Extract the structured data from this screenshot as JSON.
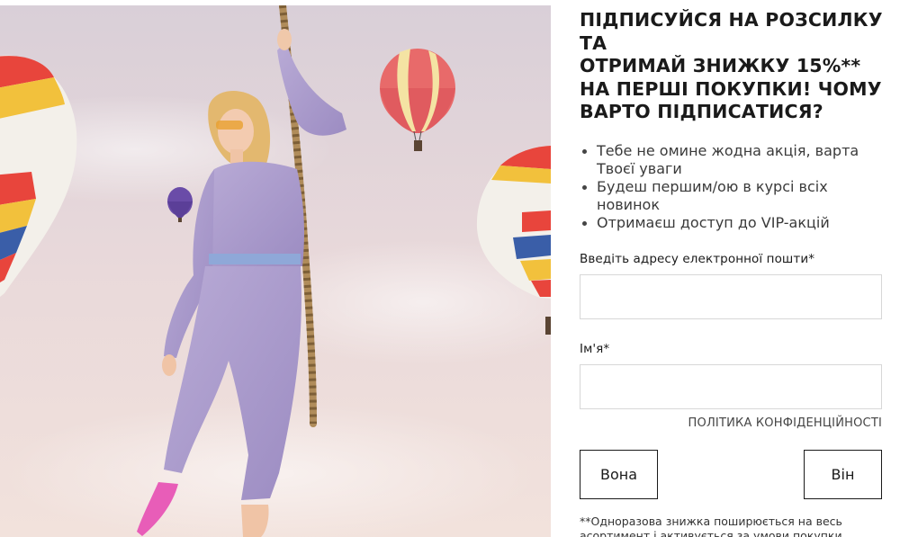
{
  "hero": {
    "alt": "Дівчина в джинсовому комбінезоні тримається за мотузку серед повітряних куль"
  },
  "headline": {
    "line1": "ПІДПИСУЙСЯ НА РОЗСИЛКУ",
    "line2": "ТА",
    "line3": "ОТРИМАЙ ЗНИЖКУ 15%**",
    "line4": "НА ПЕРШІ ПОКУПКИ! ЧОМУ",
    "line5": "ВАРТО ПІДПИСАТИСЯ?"
  },
  "benefits": [
    "Тебе не омине жодна акція, варта Твоєї уваги",
    "Будеш першим/ою в курсі всіх новинок",
    "Отримаєш доступ до VIP-акцій"
  ],
  "form": {
    "email_label": "Введіть адресу електронної пошти*",
    "email_value": "",
    "email_placeholder": "",
    "name_label": "Ім'я*",
    "name_value": "",
    "name_placeholder": "",
    "privacy_link": "ПОЛІТИКА КОНФІДЕНЦІЙНОСТІ",
    "female_button": "Вона",
    "male_button": "Він"
  },
  "footnote": "**Одноразова знижка поширюється на весь асортимент і активується за умови покупки"
}
